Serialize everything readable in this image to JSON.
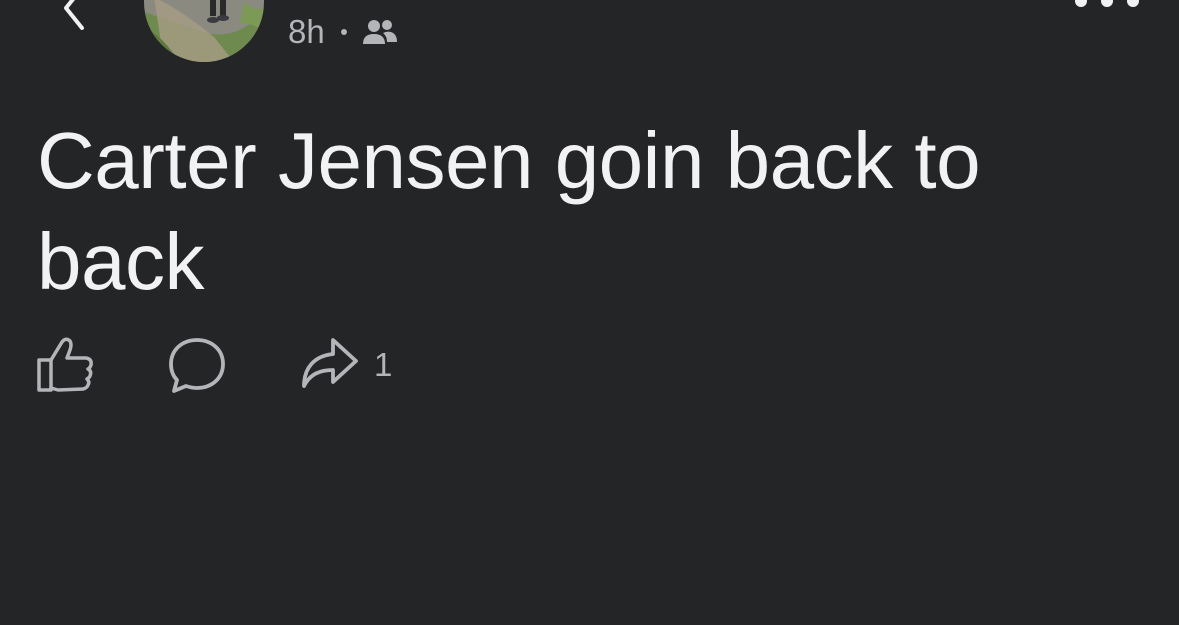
{
  "header": {
    "timestamp": "8h",
    "audience_icon": "group-icon",
    "back_icon": "chevron-left-icon",
    "more_icon": "more-dots-icon"
  },
  "post": {
    "text": "Carter Jensen goin back to back"
  },
  "actions": {
    "like_icon": "thumbs-up-icon",
    "comment_icon": "comment-icon",
    "share_icon": "share-arrow-icon",
    "share_count": "1"
  },
  "colors": {
    "background": "#242527",
    "text_primary": "#f2f2f4",
    "text_secondary": "#b3b5b9"
  }
}
